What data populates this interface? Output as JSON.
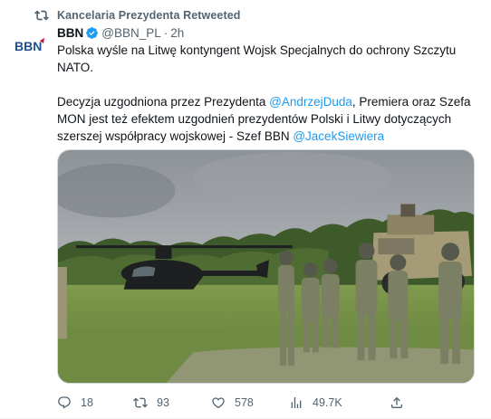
{
  "retweet_banner": {
    "text": "Kancelaria Prezydenta Retweeted",
    "icon": "retweet-icon"
  },
  "author": {
    "display_name": "BBN",
    "handle": "@BBN_PL",
    "separator": "·",
    "time": "2h",
    "avatar_text": "BBN",
    "verified_color": "#1d9bf0"
  },
  "tweet": {
    "line1": "Polska wyśle na Litwę kontyngent Wojsk Specjalnych do ochrony Szczytu NATO.",
    "para2_a": "Decyzja uzgodniona przez Prezydenta ",
    "mention1": "@AndrzejDuda",
    "para2_b": ", Premiera oraz Szefa MON jest też efektem uzgodnień prezydentów Polski i Litwy dotyczących szerszej współpracy wojskowej - Szef BBN ",
    "mention2": "@JacekSiewiera"
  },
  "actions": {
    "replies": "18",
    "reposts": "93",
    "likes": "578",
    "views": "49.7K"
  },
  "colors": {
    "accent": "#1d9bf0",
    "secondary_text": "#536471",
    "primary_text": "#0f1419"
  }
}
